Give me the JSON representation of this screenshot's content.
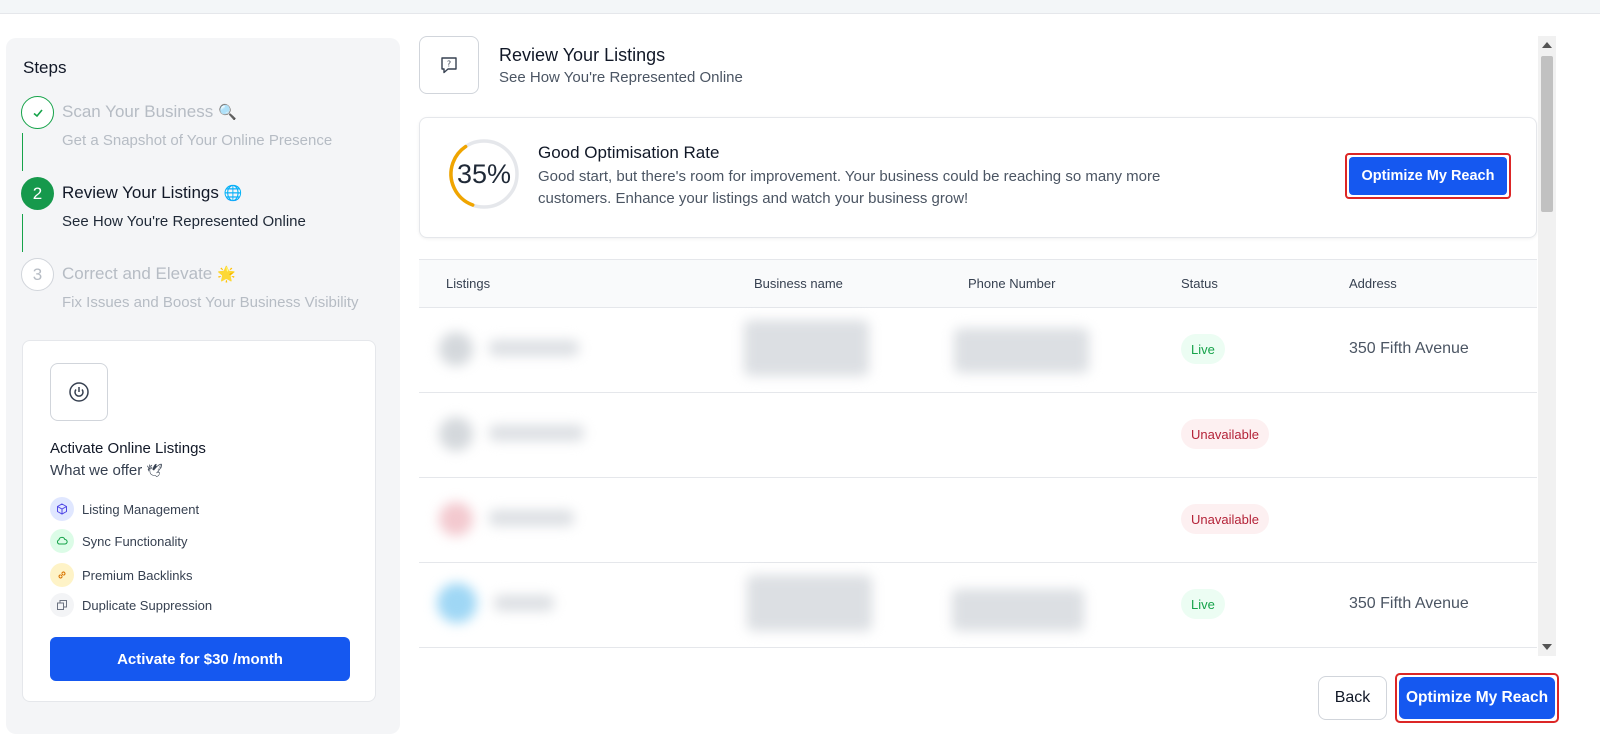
{
  "sidebar": {
    "title": "Steps",
    "steps": [
      {
        "number": "1",
        "title": "Scan Your Business",
        "emoji": "🔍",
        "subtitle": "Get a Snapshot of Your Online Presence",
        "state": "done"
      },
      {
        "number": "2",
        "title": "Review Your Listings",
        "emoji": "🌐",
        "subtitle": "See How You're Represented Online",
        "state": "active"
      },
      {
        "number": "3",
        "title": "Correct and Elevate",
        "emoji": "🌟",
        "subtitle": "Fix Issues and Boost Your Business Visibility",
        "state": "pending"
      }
    ],
    "activate": {
      "title": "Activate Online Listings",
      "subtitle": "What we offer",
      "subtitle_emoji": "🕊",
      "features": [
        {
          "label": "Listing Management",
          "icon": "cube-icon",
          "bg": "#e0e7ff",
          "fg": "#4f46e5"
        },
        {
          "label": "Sync Functionality",
          "icon": "cloud-icon",
          "bg": "#dcfce7",
          "fg": "#16a34a"
        },
        {
          "label": "Premium Backlinks",
          "icon": "link-icon",
          "bg": "#fef3c7",
          "fg": "#d97706"
        },
        {
          "label": "Duplicate Suppression",
          "icon": "copy-icon",
          "bg": "#f3f4f6",
          "fg": "#6b7280"
        }
      ],
      "button_label": "Activate for $30 /month"
    }
  },
  "header": {
    "title": "Review Your Listings",
    "subtitle": "See How You're Represented Online"
  },
  "optimisation": {
    "percent_label": "35%",
    "percent": 35,
    "title": "Good Optimisation Rate",
    "description": "Good start, but there's room for improvement. Your business could be reaching so many more customers. Enhance your listings and watch your business grow!",
    "button_label": "Optimize My Reach"
  },
  "table": {
    "columns": [
      "Listings",
      "Business name",
      "Phone Number",
      "Status",
      "Address"
    ],
    "rows": [
      {
        "status": "Live",
        "address": "350 Fifth Avenue",
        "blur_color": "#d4d8dc",
        "has_name": true,
        "has_phone": true
      },
      {
        "status": "Unavailable",
        "address": "",
        "blur_color": "#d4d8dc",
        "has_name": false,
        "has_phone": false
      },
      {
        "status": "Unavailable",
        "address": "",
        "blur_color": "#f3c9cf",
        "has_name": false,
        "has_phone": false
      },
      {
        "status": "Live",
        "address": "350 Fifth Avenue",
        "blur_color": "#9fd7f5",
        "has_name": true,
        "has_phone": true
      }
    ]
  },
  "footer": {
    "back_label": "Back",
    "optimize_label": "Optimize My Reach"
  },
  "colors": {
    "primary": "#1558f0",
    "success": "#16994c",
    "gauge": "#f0a500",
    "highlight": "#dc2626"
  }
}
